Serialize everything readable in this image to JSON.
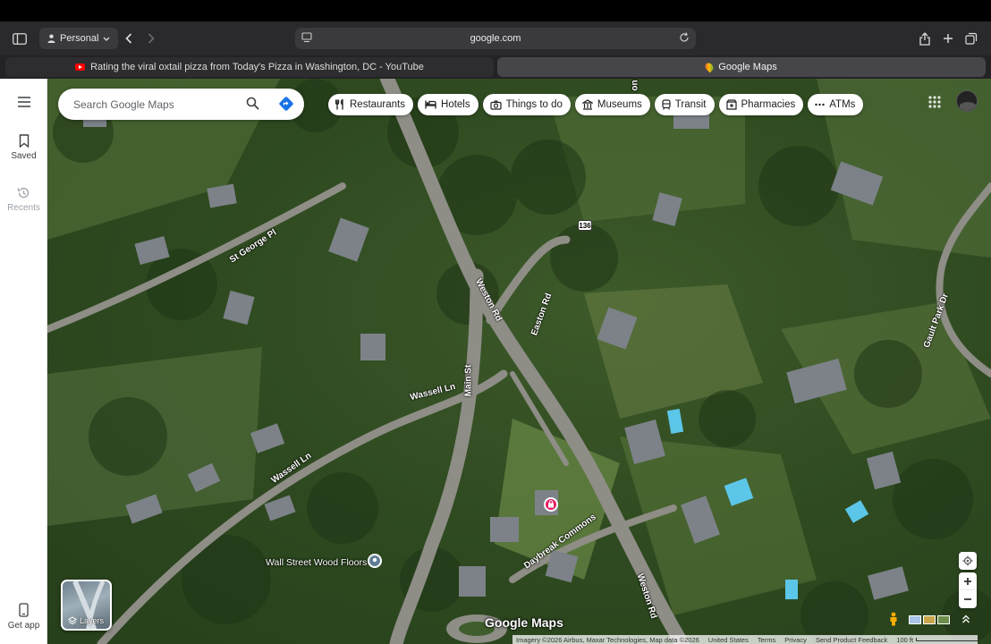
{
  "browser": {
    "profile_label": "Personal",
    "url": "google.com",
    "tabs": [
      {
        "title": "Rating the viral oxtail pizza from Today's Pizza in Washington, DC - YouTube",
        "active": false
      },
      {
        "title": "Google Maps",
        "active": true
      }
    ]
  },
  "rail": {
    "saved_label": "Saved",
    "recents_label": "Recents",
    "get_app_label": "Get app"
  },
  "search": {
    "placeholder": "Search Google Maps"
  },
  "chips": [
    {
      "label": "Restaurants",
      "icon": "fork-knife-icon"
    },
    {
      "label": "Hotels",
      "icon": "bed-icon"
    },
    {
      "label": "Things to do",
      "icon": "camera-icon"
    },
    {
      "label": "Museums",
      "icon": "museum-icon"
    },
    {
      "label": "Transit",
      "icon": "train-icon"
    },
    {
      "label": "Pharmacies",
      "icon": "pharmacy-icon"
    },
    {
      "label": "ATMs",
      "icon": "atm-icon"
    }
  ],
  "map": {
    "roads": {
      "st_george": "St George Pl",
      "weston_top": "Weston Rd",
      "weston_bottom": "Weston Rd",
      "easton": "Easton Rd",
      "main": "Main St",
      "wassell_1": "Wassell Ln",
      "wassell_2": "Wassell Ln",
      "daybreak": "Daybreak Commons",
      "gault": "Gault Park Dr"
    },
    "route_shield": "136",
    "poi": "Wall Street Wood Floors",
    "layers_label": "Layers",
    "brand": "Google Maps",
    "attribution": {
      "imagery": "Imagery ©2026 Airbus, Maxar Technologies, Map data ©2026",
      "region": "United States",
      "terms": "Terms",
      "privacy": "Privacy",
      "feedback": "Send Product Feedback",
      "scale": "100 ft"
    }
  },
  "colors": {
    "toolbar": "#2a2a2c",
    "accent_blue": "#1a73e8",
    "poi_pink": "#e91e63"
  }
}
